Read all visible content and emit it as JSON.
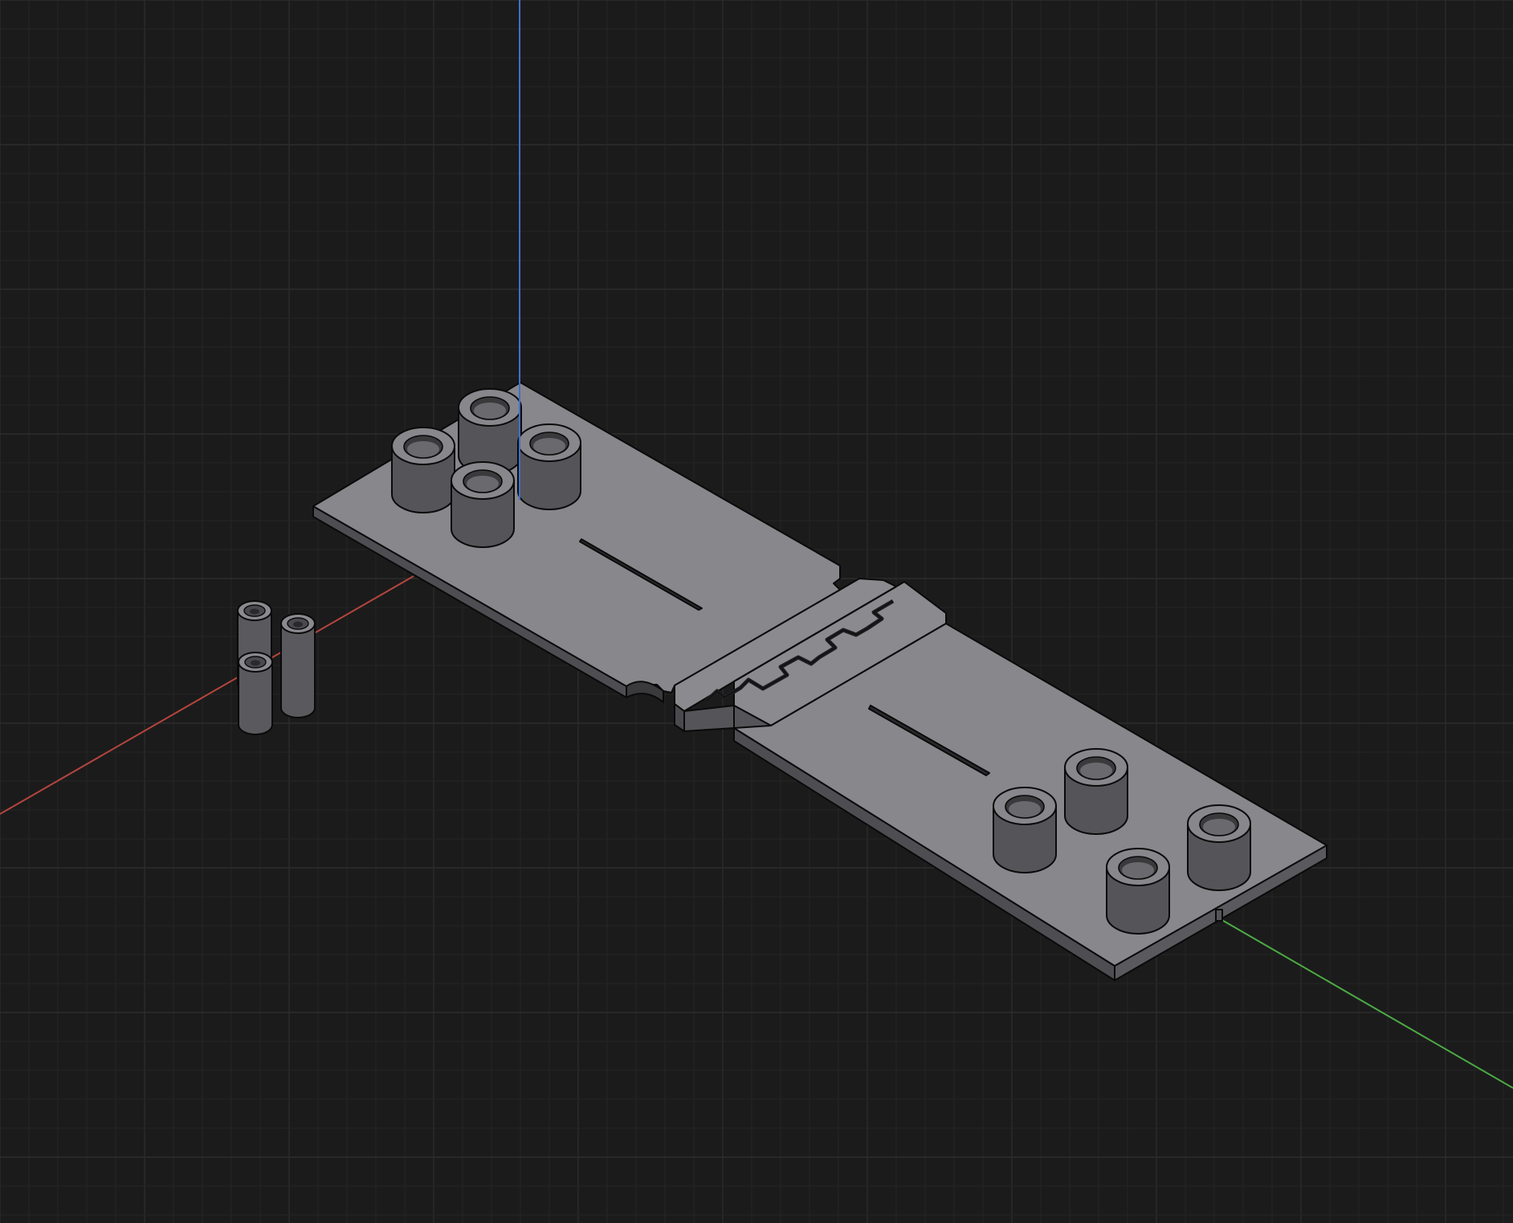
{
  "viewport": {
    "background": "#1b1b1b",
    "grid_minor_color": "#242424",
    "grid_major_color": "#2c2c2c"
  },
  "axes": {
    "x_axis_color": "#b5453e",
    "y_axis_color": "#4caa45",
    "z_axis_color": "#3f6fc9"
  },
  "model": {
    "top_color": "#87878c",
    "side_color": "#555559",
    "dark_color": "#3a3a3d",
    "edge_color": "#0a0a0a",
    "parts": [
      "hinge-plate-left",
      "hinge-joint-center",
      "hinge-plate-right",
      "standoff-boss",
      "pin"
    ]
  }
}
